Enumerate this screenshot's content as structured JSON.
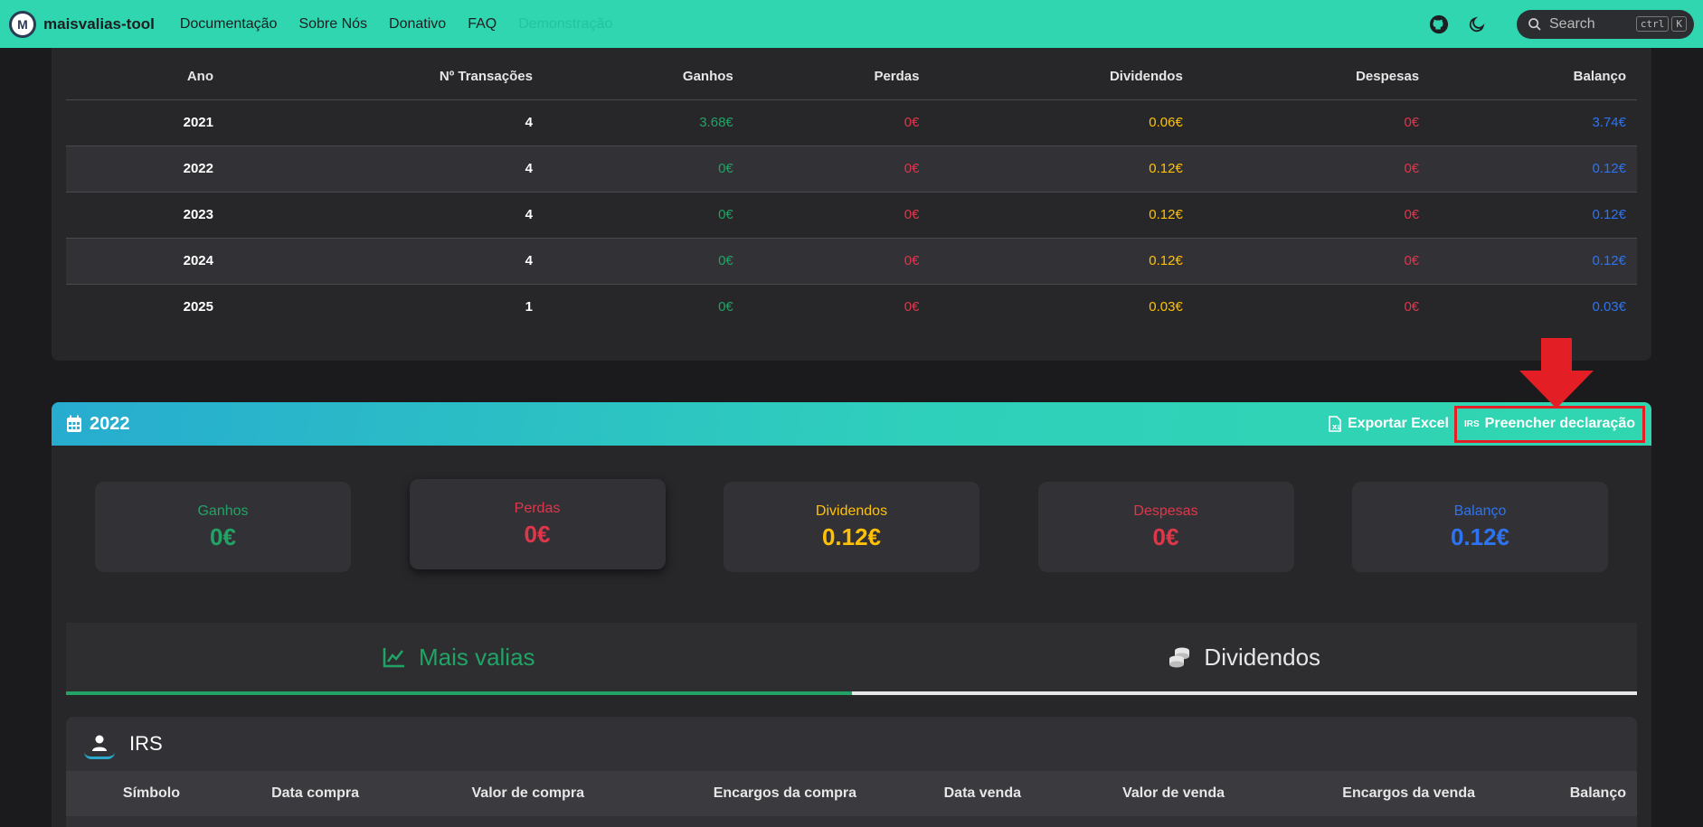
{
  "navbar": {
    "brand": "maisvalias-tool",
    "links": [
      "Documentação",
      "Sobre Nós",
      "Donativo",
      "FAQ",
      "Demonstração"
    ],
    "search": {
      "placeholder": "Search",
      "kbd1": "ctrl",
      "kbd2": "K"
    }
  },
  "summary_table": {
    "headers": [
      "Ano",
      "Nº Transações",
      "Ganhos",
      "Perdas",
      "Dividendos",
      "Despesas",
      "Balanço"
    ],
    "rows": [
      [
        "2021",
        "4",
        "3.68€",
        "0€",
        "0.06€",
        "0€",
        "3.74€"
      ],
      [
        "2022",
        "4",
        "0€",
        "0€",
        "0.12€",
        "0€",
        "0.12€"
      ],
      [
        "2023",
        "4",
        "0€",
        "0€",
        "0.12€",
        "0€",
        "0.12€"
      ],
      [
        "2024",
        "4",
        "0€",
        "0€",
        "0.12€",
        "0€",
        "0.12€"
      ],
      [
        "2025",
        "1",
        "0€",
        "0€",
        "0.03€",
        "0€",
        "0.03€"
      ]
    ]
  },
  "year_card": {
    "title": "2022",
    "export_label": "Exportar Excel",
    "irs_badge": "IRS",
    "fill_label": "Preencher declaração",
    "stats": [
      {
        "label": "Ganhos",
        "value": "0€"
      },
      {
        "label": "Perdas",
        "value": "0€"
      },
      {
        "label": "Dividendos",
        "value": "0.12€"
      },
      {
        "label": "Despesas",
        "value": "0€"
      },
      {
        "label": "Balanço",
        "value": "0.12€"
      }
    ],
    "tabs": [
      "Mais valias",
      "Dividendos"
    ],
    "irs_title": "IRS",
    "irs_headers": [
      "Símbolo",
      "Data compra",
      "Valor de compra",
      "Encargos da compra",
      "Data venda",
      "Valor de venda",
      "Encargos da venda",
      "Balanço"
    ]
  },
  "colors": {
    "nav_bg": "#30d6b0",
    "gains": "#22a366",
    "losses": "#e0364a",
    "dividends": "#ffc107",
    "balance": "#2e74f2",
    "highlight": "#e31e24"
  }
}
